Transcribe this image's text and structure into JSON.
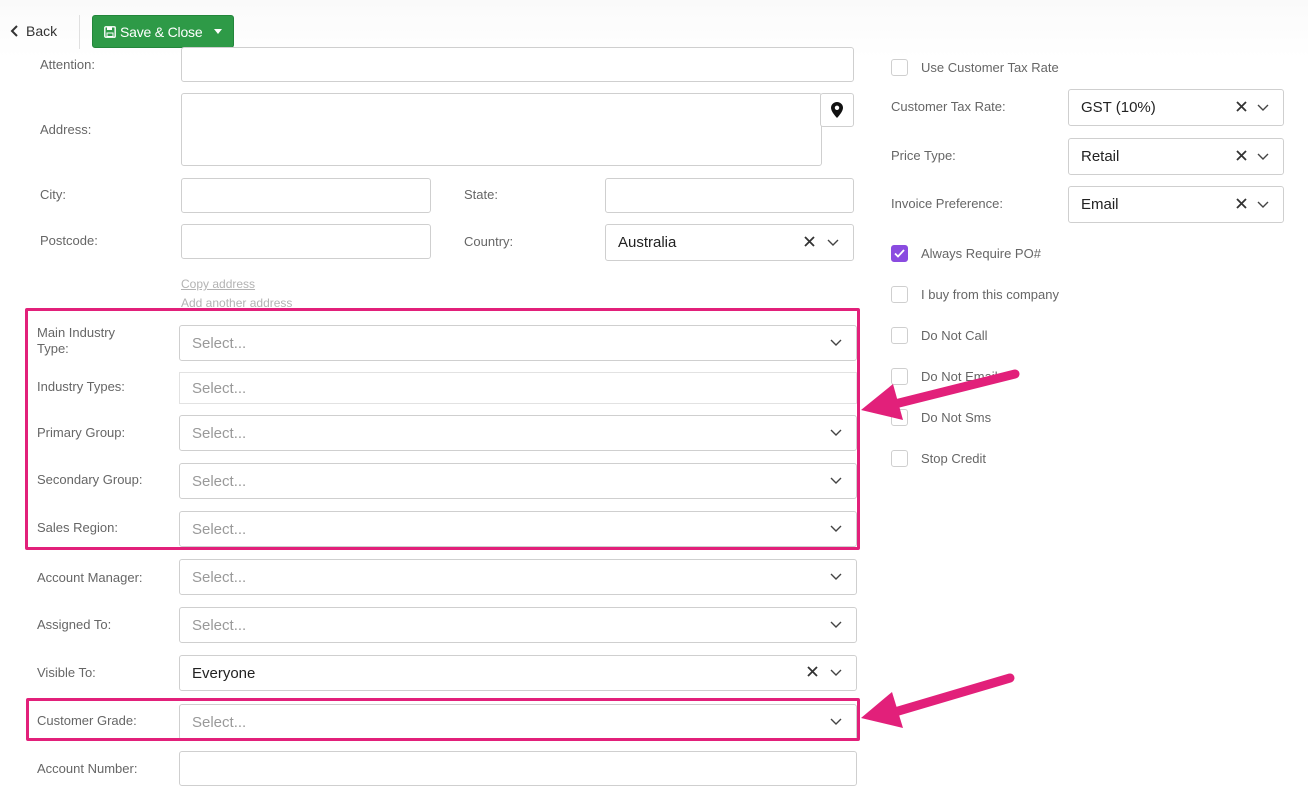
{
  "toolbar": {
    "back_label": "Back",
    "save_close_label": "Save & Close"
  },
  "form": {
    "attention_label": "Attention:",
    "address_label": "Address:",
    "city_label": "City:",
    "state_label": "State:",
    "postcode_label": "Postcode:",
    "country_label": "Country:",
    "country_value": "Australia",
    "copy_address_link": "Copy address",
    "add_address_link": "Add another address",
    "main_industry_type_label": "Main Industry Type:",
    "industry_types_label": "Industry Types:",
    "primary_group_label": "Primary Group:",
    "secondary_group_label": "Secondary Group:",
    "sales_region_label": "Sales Region:",
    "account_manager_label": "Account Manager:",
    "assigned_to_label": "Assigned To:",
    "visible_to_label": "Visible To:",
    "visible_to_value": "Everyone",
    "customer_grade_label": "Customer Grade:",
    "account_number_label": "Account Number:",
    "select_placeholder": "Select..."
  },
  "right": {
    "use_customer_tax_rate_label": "Use Customer Tax Rate",
    "customer_tax_rate_label": "Customer Tax Rate:",
    "customer_tax_rate_value": "GST (10%)",
    "price_type_label": "Price Type:",
    "price_type_value": "Retail",
    "invoice_preference_label": "Invoice Preference:",
    "invoice_preference_value": "Email",
    "checkboxes": [
      {
        "label": "Always Require PO#",
        "checked": true
      },
      {
        "label": "I buy from this company",
        "checked": false
      },
      {
        "label": "Do Not Call",
        "checked": false
      },
      {
        "label": "Do Not Email",
        "checked": false
      },
      {
        "label": "Do Not Sms",
        "checked": false
      },
      {
        "label": "Stop Credit",
        "checked": false
      }
    ]
  },
  "colors": {
    "save_green": "#2e9a47",
    "highlight_pink": "#e2207a",
    "checkbox_purple": "#8a4be0"
  }
}
